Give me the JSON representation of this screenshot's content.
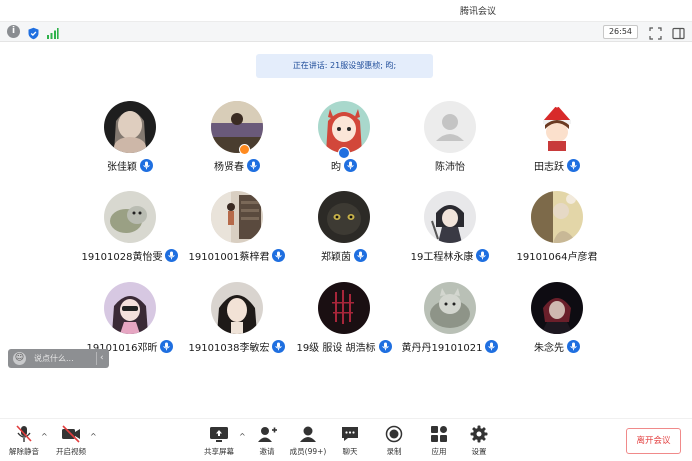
{
  "window": {
    "title": "腾讯会议"
  },
  "status": {
    "timer": "26:54"
  },
  "speaking": {
    "text": "正在讲话: 21服设邹惠桢; 昀;"
  },
  "participants": [
    {
      "name": "张佳颖",
      "mic": true
    },
    {
      "name": "杨贤春",
      "mic": true
    },
    {
      "name": "昀",
      "mic": true
    },
    {
      "name": "陈沛怡",
      "mic": false
    },
    {
      "name": "田志跃",
      "mic": true
    },
    {
      "name": "19101028黄怡雯",
      "mic": true
    },
    {
      "name": "19101001蔡梓君",
      "mic": true
    },
    {
      "name": "郑颖茵",
      "mic": true
    },
    {
      "name": "19工程林永康",
      "mic": true
    },
    {
      "name": "19101064卢彦君",
      "mic": false
    },
    {
      "name": "19101016邓昕",
      "mic": true
    },
    {
      "name": "19101038李敏宏",
      "mic": true
    },
    {
      "name": "19级 服设 胡浩标",
      "mic": true
    },
    {
      "name": "黄丹丹19101021",
      "mic": true
    },
    {
      "name": "朱念先",
      "mic": true
    }
  ],
  "chat": {
    "placeholder": "说点什么...",
    "expand_icon": "chevron-left-icon"
  },
  "toolbar": {
    "unmute_label": "解除静音",
    "video_label": "开启视频",
    "share_label": "共享屏幕",
    "invite_label": "邀请",
    "members_label": "成员(99+)",
    "chat_label": "聊天",
    "record_label": "录制",
    "apps_label": "应用",
    "settings_label": "设置",
    "leave_label": "离开会议"
  },
  "colors": {
    "accent": "#1f6fe0",
    "danger": "#e23d3d",
    "banner_bg": "#e4edfb"
  }
}
